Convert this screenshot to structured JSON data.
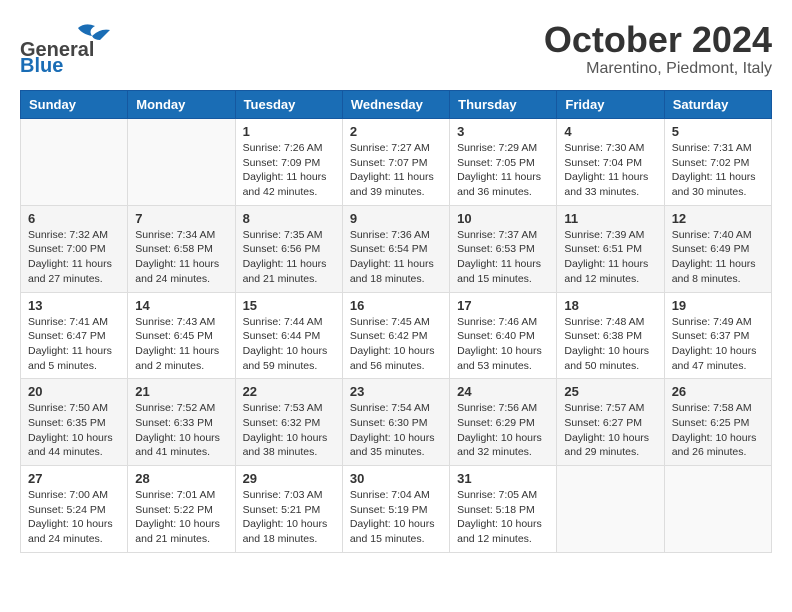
{
  "header": {
    "logo": {
      "general": "General",
      "blue": "Blue"
    },
    "title": "October 2024",
    "location": "Marentino, Piedmont, Italy"
  },
  "weekdays": [
    "Sunday",
    "Monday",
    "Tuesday",
    "Wednesday",
    "Thursday",
    "Friday",
    "Saturday"
  ],
  "weeks": [
    [
      {
        "day": "",
        "info": ""
      },
      {
        "day": "",
        "info": ""
      },
      {
        "day": "1",
        "info": "Sunrise: 7:26 AM\nSunset: 7:09 PM\nDaylight: 11 hours and 42 minutes."
      },
      {
        "day": "2",
        "info": "Sunrise: 7:27 AM\nSunset: 7:07 PM\nDaylight: 11 hours and 39 minutes."
      },
      {
        "day": "3",
        "info": "Sunrise: 7:29 AM\nSunset: 7:05 PM\nDaylight: 11 hours and 36 minutes."
      },
      {
        "day": "4",
        "info": "Sunrise: 7:30 AM\nSunset: 7:04 PM\nDaylight: 11 hours and 33 minutes."
      },
      {
        "day": "5",
        "info": "Sunrise: 7:31 AM\nSunset: 7:02 PM\nDaylight: 11 hours and 30 minutes."
      }
    ],
    [
      {
        "day": "6",
        "info": "Sunrise: 7:32 AM\nSunset: 7:00 PM\nDaylight: 11 hours and 27 minutes."
      },
      {
        "day": "7",
        "info": "Sunrise: 7:34 AM\nSunset: 6:58 PM\nDaylight: 11 hours and 24 minutes."
      },
      {
        "day": "8",
        "info": "Sunrise: 7:35 AM\nSunset: 6:56 PM\nDaylight: 11 hours and 21 minutes."
      },
      {
        "day": "9",
        "info": "Sunrise: 7:36 AM\nSunset: 6:54 PM\nDaylight: 11 hours and 18 minutes."
      },
      {
        "day": "10",
        "info": "Sunrise: 7:37 AM\nSunset: 6:53 PM\nDaylight: 11 hours and 15 minutes."
      },
      {
        "day": "11",
        "info": "Sunrise: 7:39 AM\nSunset: 6:51 PM\nDaylight: 11 hours and 12 minutes."
      },
      {
        "day": "12",
        "info": "Sunrise: 7:40 AM\nSunset: 6:49 PM\nDaylight: 11 hours and 8 minutes."
      }
    ],
    [
      {
        "day": "13",
        "info": "Sunrise: 7:41 AM\nSunset: 6:47 PM\nDaylight: 11 hours and 5 minutes."
      },
      {
        "day": "14",
        "info": "Sunrise: 7:43 AM\nSunset: 6:45 PM\nDaylight: 11 hours and 2 minutes."
      },
      {
        "day": "15",
        "info": "Sunrise: 7:44 AM\nSunset: 6:44 PM\nDaylight: 10 hours and 59 minutes."
      },
      {
        "day": "16",
        "info": "Sunrise: 7:45 AM\nSunset: 6:42 PM\nDaylight: 10 hours and 56 minutes."
      },
      {
        "day": "17",
        "info": "Sunrise: 7:46 AM\nSunset: 6:40 PM\nDaylight: 10 hours and 53 minutes."
      },
      {
        "day": "18",
        "info": "Sunrise: 7:48 AM\nSunset: 6:38 PM\nDaylight: 10 hours and 50 minutes."
      },
      {
        "day": "19",
        "info": "Sunrise: 7:49 AM\nSunset: 6:37 PM\nDaylight: 10 hours and 47 minutes."
      }
    ],
    [
      {
        "day": "20",
        "info": "Sunrise: 7:50 AM\nSunset: 6:35 PM\nDaylight: 10 hours and 44 minutes."
      },
      {
        "day": "21",
        "info": "Sunrise: 7:52 AM\nSunset: 6:33 PM\nDaylight: 10 hours and 41 minutes."
      },
      {
        "day": "22",
        "info": "Sunrise: 7:53 AM\nSunset: 6:32 PM\nDaylight: 10 hours and 38 minutes."
      },
      {
        "day": "23",
        "info": "Sunrise: 7:54 AM\nSunset: 6:30 PM\nDaylight: 10 hours and 35 minutes."
      },
      {
        "day": "24",
        "info": "Sunrise: 7:56 AM\nSunset: 6:29 PM\nDaylight: 10 hours and 32 minutes."
      },
      {
        "day": "25",
        "info": "Sunrise: 7:57 AM\nSunset: 6:27 PM\nDaylight: 10 hours and 29 minutes."
      },
      {
        "day": "26",
        "info": "Sunrise: 7:58 AM\nSunset: 6:25 PM\nDaylight: 10 hours and 26 minutes."
      }
    ],
    [
      {
        "day": "27",
        "info": "Sunrise: 7:00 AM\nSunset: 5:24 PM\nDaylight: 10 hours and 24 minutes."
      },
      {
        "day": "28",
        "info": "Sunrise: 7:01 AM\nSunset: 5:22 PM\nDaylight: 10 hours and 21 minutes."
      },
      {
        "day": "29",
        "info": "Sunrise: 7:03 AM\nSunset: 5:21 PM\nDaylight: 10 hours and 18 minutes."
      },
      {
        "day": "30",
        "info": "Sunrise: 7:04 AM\nSunset: 5:19 PM\nDaylight: 10 hours and 15 minutes."
      },
      {
        "day": "31",
        "info": "Sunrise: 7:05 AM\nSunset: 5:18 PM\nDaylight: 10 hours and 12 minutes."
      },
      {
        "day": "",
        "info": ""
      },
      {
        "day": "",
        "info": ""
      }
    ]
  ]
}
